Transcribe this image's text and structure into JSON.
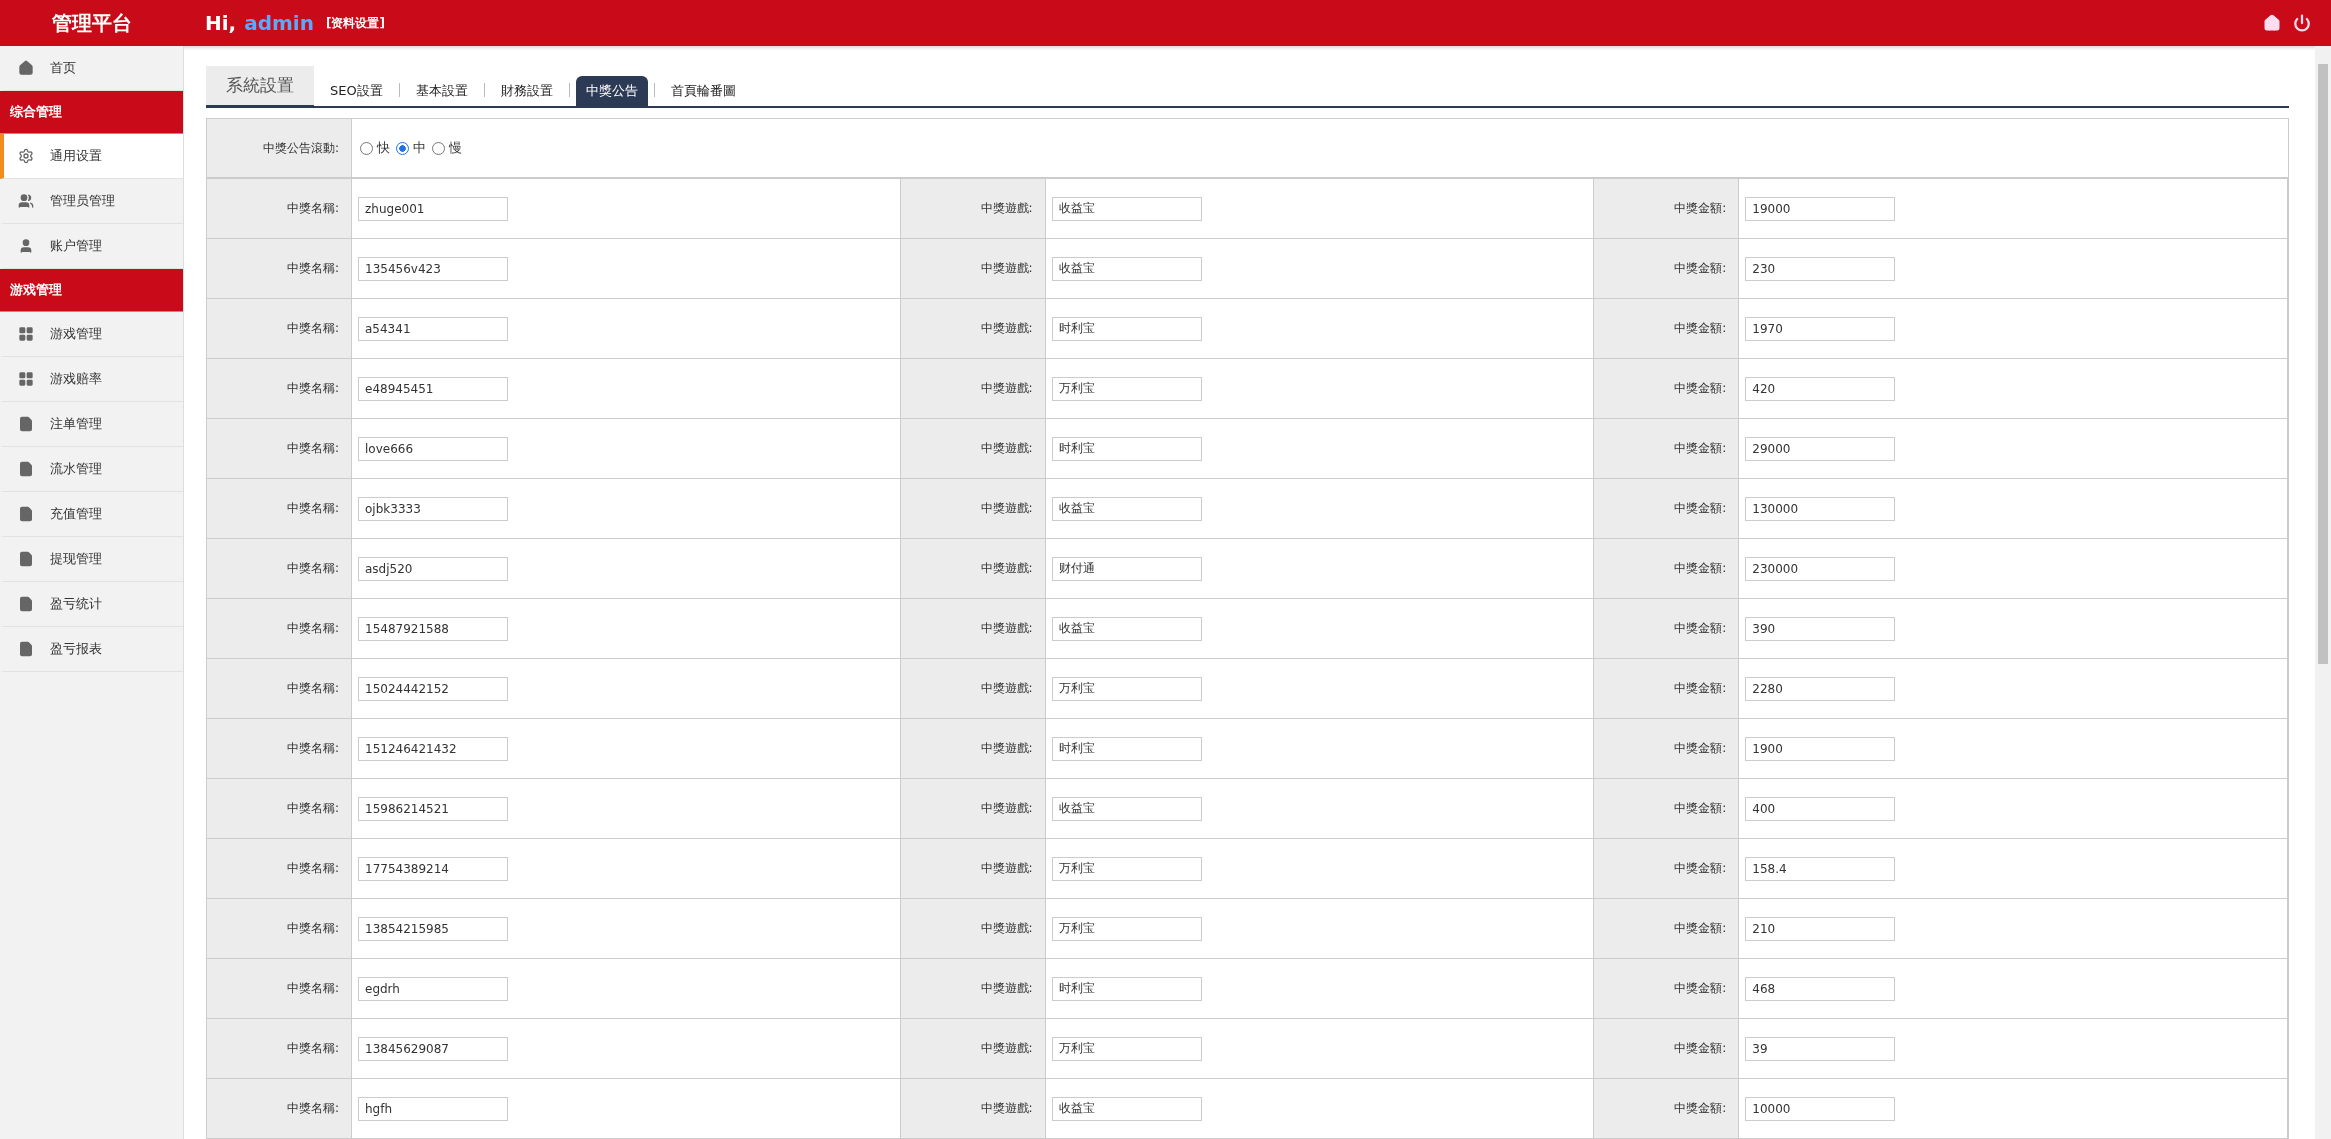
{
  "header": {
    "brand": "管理平台",
    "greeting": "Hi,",
    "user": "admin",
    "profile_link": "[资料设置]"
  },
  "sidebar": {
    "items": [
      {
        "kind": "item",
        "label": "首页",
        "selected": false
      },
      {
        "kind": "section",
        "label": "综合管理"
      },
      {
        "kind": "item",
        "label": "通用设置",
        "selected": true
      },
      {
        "kind": "item",
        "label": "管理员管理",
        "selected": false
      },
      {
        "kind": "item",
        "label": "账户管理",
        "selected": false
      },
      {
        "kind": "section",
        "label": "游戏管理"
      },
      {
        "kind": "item",
        "label": "游戏管理",
        "selected": false
      },
      {
        "kind": "item",
        "label": "游戏赔率",
        "selected": false
      },
      {
        "kind": "item",
        "label": "注单管理",
        "selected": false
      },
      {
        "kind": "item",
        "label": "流水管理",
        "selected": false
      },
      {
        "kind": "item",
        "label": "充值管理",
        "selected": false
      },
      {
        "kind": "item",
        "label": "提现管理",
        "selected": false
      },
      {
        "kind": "item",
        "label": "盈亏统计",
        "selected": false
      },
      {
        "kind": "item",
        "label": "盈亏报表",
        "selected": false
      }
    ]
  },
  "panel_title": "系統設置",
  "tabs": [
    {
      "label": "SEO設置",
      "selected": false
    },
    {
      "label": "基本設置",
      "selected": false
    },
    {
      "label": "財務設置",
      "selected": false
    },
    {
      "label": "中獎公告",
      "selected": true
    },
    {
      "label": "首頁輪番圖",
      "selected": false
    }
  ],
  "scroll_setting": {
    "label": "中獎公告滾動:",
    "options": [
      {
        "label": "快",
        "selected": false
      },
      {
        "label": "中",
        "selected": true
      },
      {
        "label": "慢",
        "selected": false
      }
    ]
  },
  "rows": [
    {
      "name_label": "中獎名稱:",
      "name": "zhuge001",
      "game_label": "中獎遊戲:",
      "game": "收益宝",
      "amount_label": "中獎金額:",
      "amount": "19000"
    },
    {
      "name_label": "中獎名稱:",
      "name": "135456v423",
      "game_label": "中獎遊戲:",
      "game": "收益宝",
      "amount_label": "中獎金額:",
      "amount": "230"
    },
    {
      "name_label": "中獎名稱:",
      "name": "a54341",
      "game_label": "中獎遊戲:",
      "game": "时利宝",
      "amount_label": "中獎金額:",
      "amount": "1970"
    },
    {
      "name_label": "中獎名稱:",
      "name": "e48945451",
      "game_label": "中獎遊戲:",
      "game": "万利宝",
      "amount_label": "中獎金額:",
      "amount": "420"
    },
    {
      "name_label": "中獎名稱:",
      "name": "love666",
      "game_label": "中獎遊戲:",
      "game": "时利宝",
      "amount_label": "中獎金額:",
      "amount": "29000"
    },
    {
      "name_label": "中獎名稱:",
      "name": "ojbk3333",
      "game_label": "中獎遊戲:",
      "game": "收益宝",
      "amount_label": "中獎金額:",
      "amount": "130000"
    },
    {
      "name_label": "中獎名稱:",
      "name": "asdj520",
      "game_label": "中獎遊戲:",
      "game": "财付通",
      "amount_label": "中獎金額:",
      "amount": "230000"
    },
    {
      "name_label": "中獎名稱:",
      "name": "15487921588",
      "game_label": "中獎遊戲:",
      "game": "收益宝",
      "amount_label": "中獎金額:",
      "amount": "390"
    },
    {
      "name_label": "中獎名稱:",
      "name": "15024442152",
      "game_label": "中獎遊戲:",
      "game": "万利宝",
      "amount_label": "中獎金額:",
      "amount": "2280"
    },
    {
      "name_label": "中獎名稱:",
      "name": "151246421432",
      "game_label": "中獎遊戲:",
      "game": "时利宝",
      "amount_label": "中獎金額:",
      "amount": "1900"
    },
    {
      "name_label": "中獎名稱:",
      "name": "15986214521",
      "game_label": "中獎遊戲:",
      "game": "收益宝",
      "amount_label": "中獎金額:",
      "amount": "400"
    },
    {
      "name_label": "中獎名稱:",
      "name": "17754389214",
      "game_label": "中獎遊戲:",
      "game": "万利宝",
      "amount_label": "中獎金額:",
      "amount": "158.4"
    },
    {
      "name_label": "中獎名稱:",
      "name": "13854215985",
      "game_label": "中獎遊戲:",
      "game": "万利宝",
      "amount_label": "中獎金額:",
      "amount": "210"
    },
    {
      "name_label": "中獎名稱:",
      "name": "egdrh",
      "game_label": "中獎遊戲:",
      "game": "时利宝",
      "amount_label": "中獎金額:",
      "amount": "468"
    },
    {
      "name_label": "中獎名稱:",
      "name": "13845629087",
      "game_label": "中獎遊戲:",
      "game": "万利宝",
      "amount_label": "中獎金額:",
      "amount": "39"
    },
    {
      "name_label": "中獎名稱:",
      "name": "hgfh",
      "game_label": "中獎遊戲:",
      "game": "收益宝",
      "amount_label": "中獎金額:",
      "amount": "10000"
    }
  ]
}
